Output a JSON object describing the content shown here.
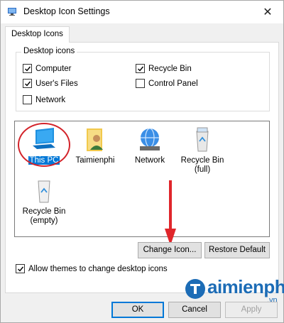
{
  "window": {
    "title": "Desktop Icon Settings",
    "close_glyph": "✕"
  },
  "tabs": [
    {
      "label": "Desktop Icons"
    }
  ],
  "desktop_icons_group": {
    "label": "Desktop icons",
    "checkboxes": [
      {
        "label": "Computer",
        "checked": true
      },
      {
        "label": "User's Files",
        "checked": true
      },
      {
        "label": "Network",
        "checked": false
      },
      {
        "label": "Recycle Bin",
        "checked": true
      },
      {
        "label": "Control Panel",
        "checked": false
      }
    ]
  },
  "icon_list": [
    {
      "label": "This PC",
      "selected": true,
      "icon": "this-pc-icon"
    },
    {
      "label": "Taimienphi",
      "selected": false,
      "icon": "user-folder-icon"
    },
    {
      "label": "Network",
      "selected": false,
      "icon": "network-icon"
    },
    {
      "label_line1": "Recycle Bin",
      "label_line2": "(full)",
      "selected": false,
      "icon": "recycle-bin-full-icon"
    },
    {
      "label_line1": "Recycle Bin",
      "label_line2": "(empty)",
      "selected": false,
      "icon": "recycle-bin-empty-icon"
    }
  ],
  "buttons": {
    "change_icon": "Change Icon...",
    "restore_default": "Restore Default",
    "ok": "OK",
    "cancel": "Cancel",
    "apply": "Apply"
  },
  "allow_themes": {
    "label": "Allow themes to change desktop icons",
    "checked": true
  },
  "watermark": {
    "brand": "aimienphi",
    "suffix": ".vn"
  },
  "colors": {
    "annotation_red": "#d3232a",
    "selection_blue": "#0078d7",
    "brand_blue": "#1c6cb6"
  }
}
